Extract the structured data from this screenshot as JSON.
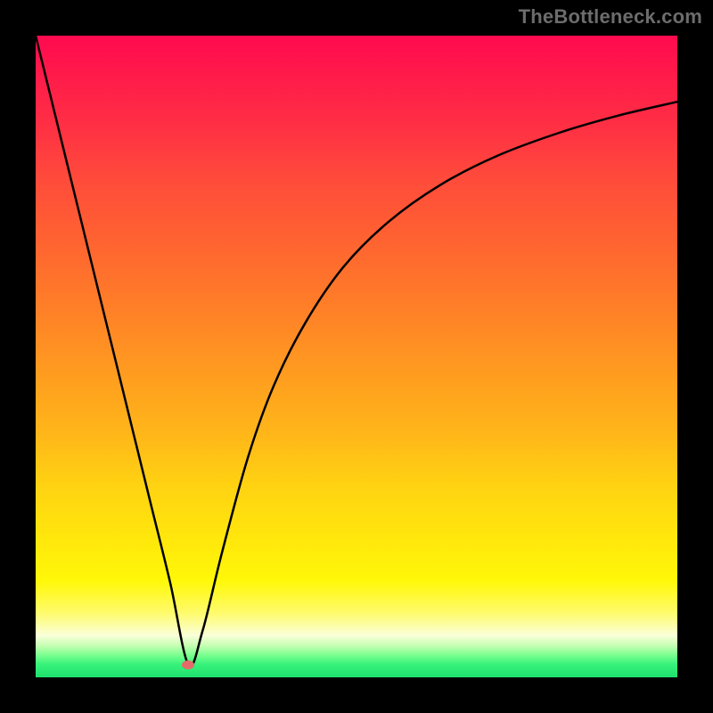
{
  "watermark": "TheBottleneck.com",
  "chart_data": {
    "type": "line",
    "title": "",
    "xlabel": "",
    "ylabel": "",
    "xlim": [
      0,
      1
    ],
    "ylim": [
      0,
      1
    ],
    "series": [
      {
        "name": "curve",
        "x": [
          0.0,
          0.03,
          0.06,
          0.09,
          0.12,
          0.15,
          0.18,
          0.21,
          0.238,
          0.26,
          0.29,
          0.33,
          0.37,
          0.42,
          0.48,
          0.55,
          0.63,
          0.72,
          0.82,
          0.91,
          1.0
        ],
        "values": [
          1.0,
          0.878,
          0.756,
          0.634,
          0.512,
          0.39,
          0.268,
          0.146,
          0.02,
          0.072,
          0.193,
          0.34,
          0.452,
          0.552,
          0.64,
          0.71,
          0.767,
          0.813,
          0.85,
          0.876,
          0.897
        ]
      }
    ],
    "marker": {
      "x": 0.238,
      "y": 0.02,
      "color": "#e46a6a"
    },
    "gradient_stops": [
      {
        "pos": 0.0,
        "color": "#ff0a4f"
      },
      {
        "pos": 0.5,
        "color": "#ff9a20"
      },
      {
        "pos": 0.85,
        "color": "#fff808"
      },
      {
        "pos": 1.0,
        "color": "#1ee06e"
      }
    ]
  }
}
